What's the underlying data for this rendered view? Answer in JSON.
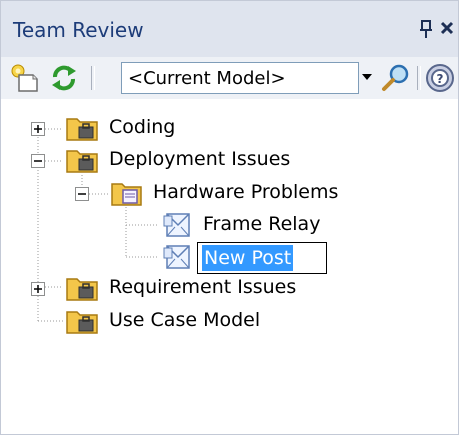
{
  "window": {
    "title": "Team Review"
  },
  "toolbar": {
    "model_select_value": "<Current Model>"
  },
  "tree": {
    "coding": "Coding",
    "deployment": "Deployment Issues",
    "hardware": "Hardware Problems",
    "frame_relay": "Frame Relay",
    "new_post": "New Post",
    "requirement": "Requirement Issues",
    "use_case": "Use Case Model"
  },
  "colors": {
    "title_text": "#1d3c79",
    "titlebar_bg": "#dfe4ee",
    "toolbar_bg": "#eef1f6",
    "selection": "#3399ff"
  }
}
